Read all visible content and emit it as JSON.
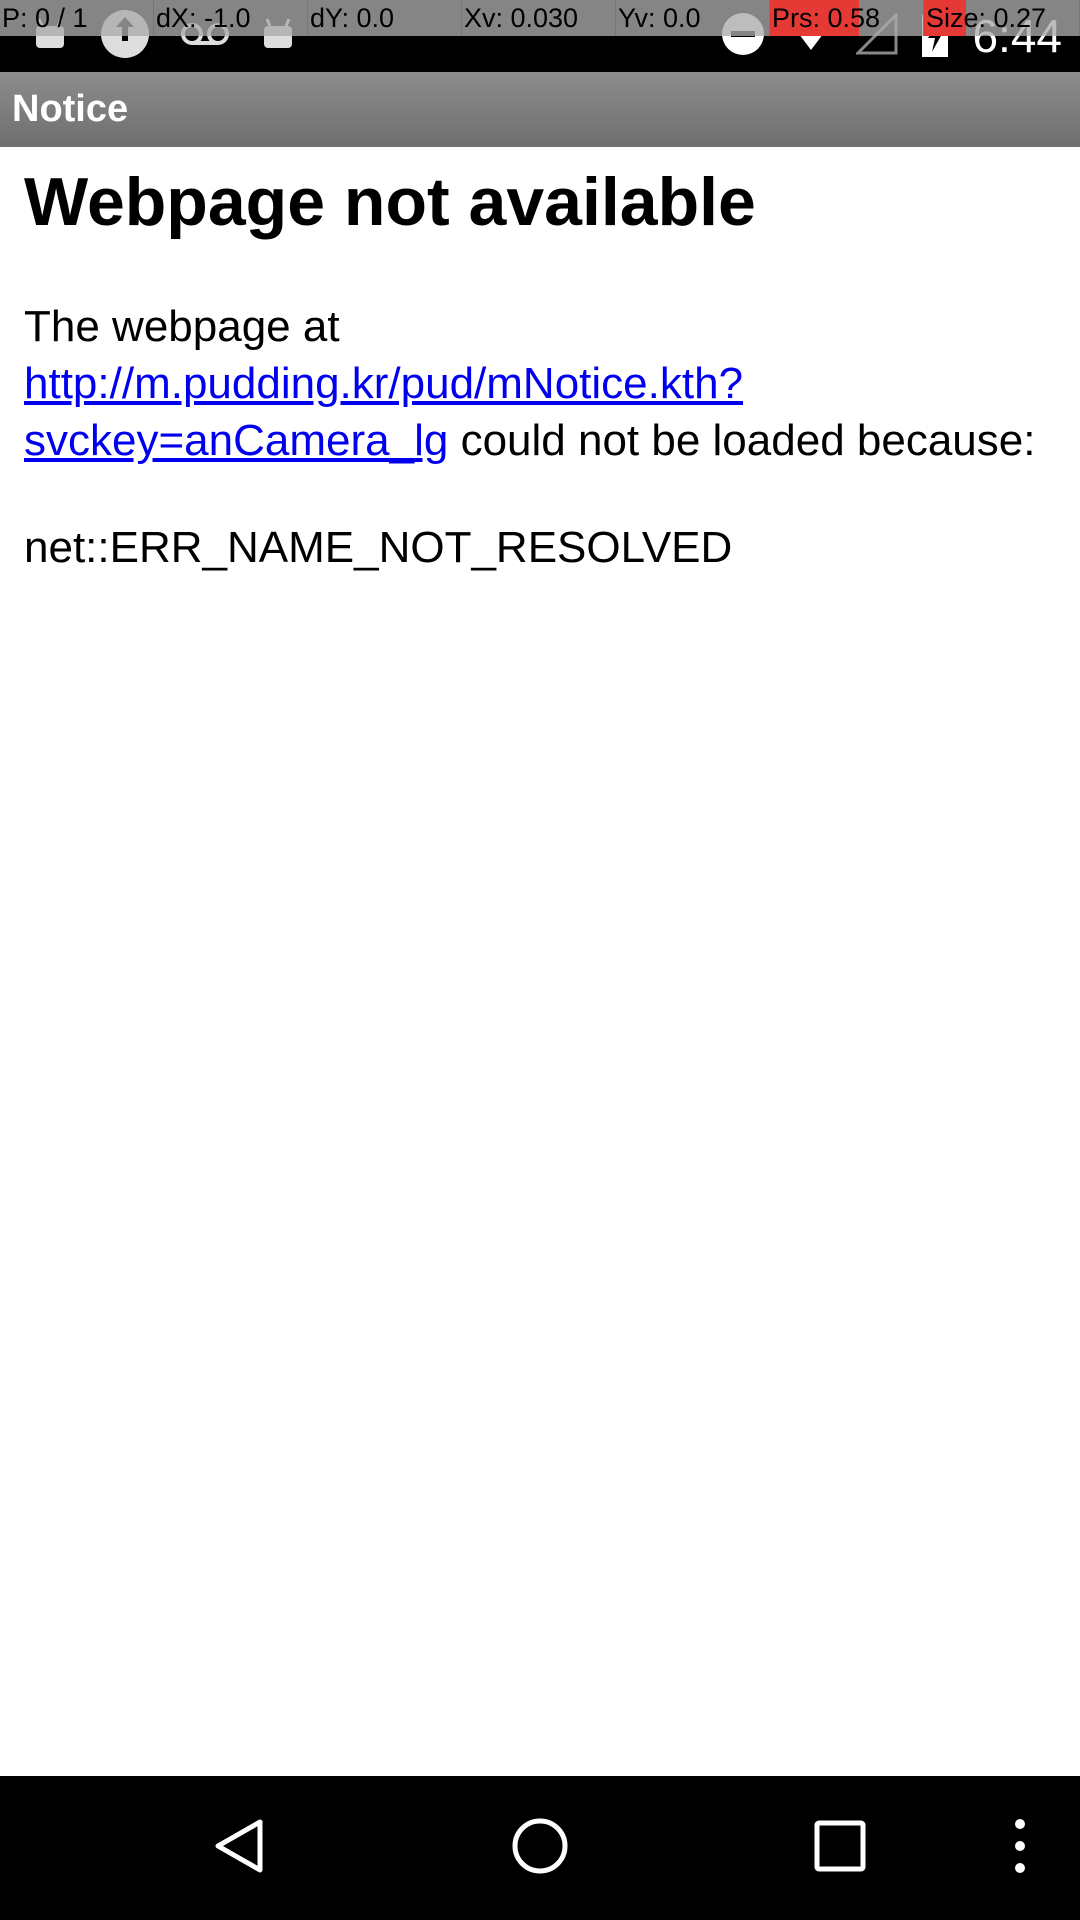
{
  "status_bar": {
    "clock": "6:44",
    "left_icons": [
      "android-icon",
      "sync-icon",
      "voicemail-icon",
      "android-icon"
    ],
    "right_icons": [
      "do-not-disturb-icon",
      "wifi-icon",
      "signal-icon",
      "battery-icon"
    ]
  },
  "pointer_overlay": {
    "cells": [
      {
        "text": "P: 0 / 1"
      },
      {
        "text": "dX: -1.0"
      },
      {
        "text": "dY: 0.0"
      },
      {
        "text": "Xv: 0.030"
      },
      {
        "text": "Yv: 0.0"
      },
      {
        "text": "Prs: 0.58",
        "highlight": 0.58
      },
      {
        "text": "Size: 0.27",
        "highlight": 0.27
      }
    ],
    "highlight_color": "#e53935"
  },
  "app_bar": {
    "title": "Notice"
  },
  "content": {
    "heading": "Webpage not available",
    "message_prefix": "The webpage at",
    "url": "http://m.pudding.kr/pud/mNotice.kth?svckey=anCamera_lg",
    "message_suffix": "could not be loaded because:",
    "error_code": "net::ERR_NAME_NOT_RESOLVED",
    "link_color": "#0000ee"
  },
  "nav_bar": {
    "buttons": [
      "back-icon",
      "home-icon",
      "recents-icon",
      "overflow-menu-icon"
    ]
  }
}
